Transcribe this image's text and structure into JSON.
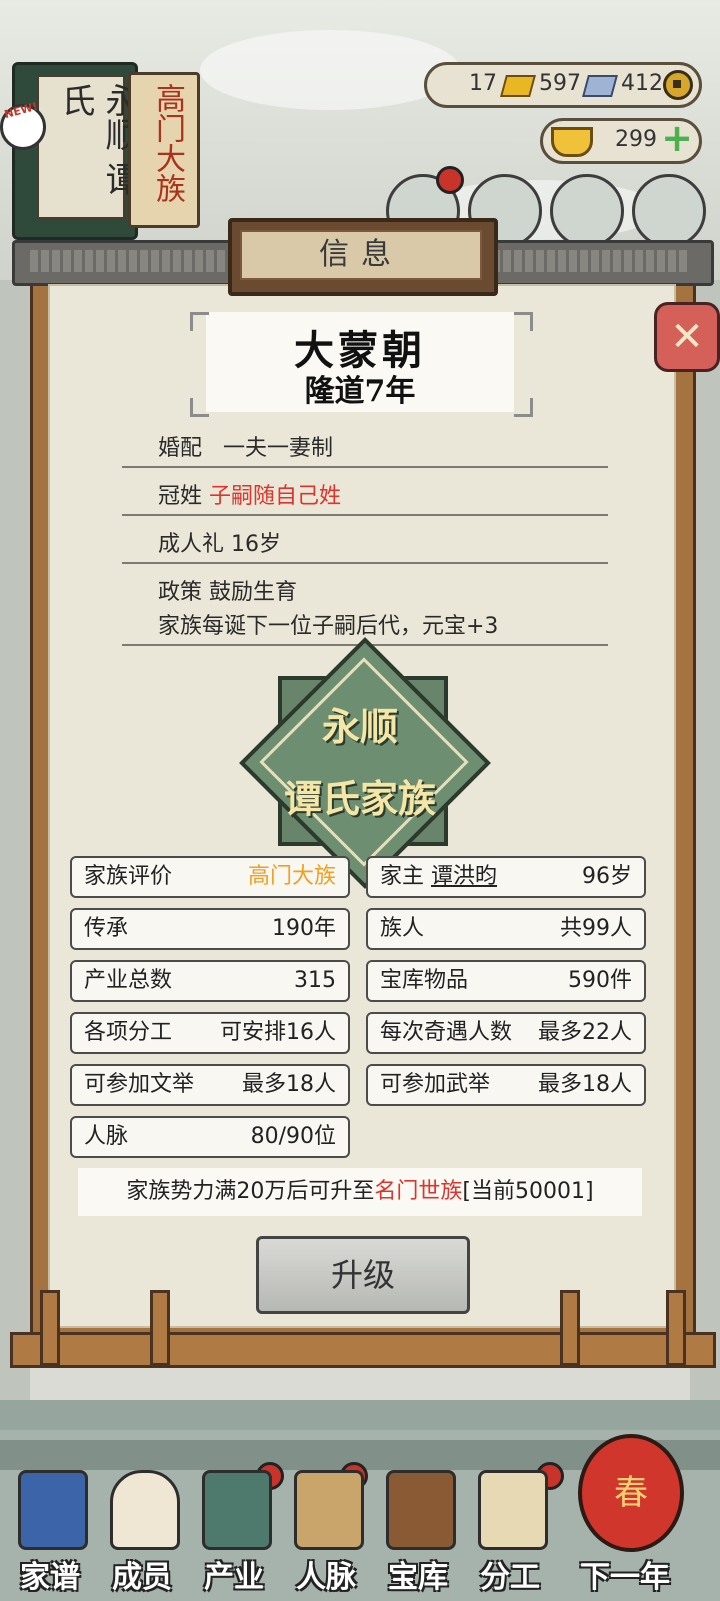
{
  "top_left": {
    "book_title": "永顺 谭氏",
    "book_subtitle": "高门大族",
    "new_badge": "NEW!"
  },
  "resources": {
    "gold_bars": "17",
    "silver_bars": "597",
    "coins": "412",
    "yuanbao": "299"
  },
  "dialog": {
    "title": "信息",
    "close_icon": "close-icon",
    "dynasty": "大蒙朝",
    "year": "隆道7年",
    "rules": [
      {
        "label": "婚配",
        "value": "一夫一妻制"
      },
      {
        "label": "冠姓",
        "value": "子嗣随自己姓"
      },
      {
        "label": "成人礼",
        "value": "16岁"
      },
      {
        "label": "政策",
        "value": "鼓励生育"
      }
    ],
    "policy_effect": "家族每诞下一位子嗣后代，元宝+3",
    "emblem": {
      "line1": "永顺",
      "line2": "谭氏家族"
    },
    "stats_left": [
      {
        "label": "家族评价",
        "value": "高门大族"
      },
      {
        "label": "传承",
        "value": "190年"
      },
      {
        "label": "产业总数",
        "value": "315"
      },
      {
        "label": "各项分工",
        "value": "可安排16人"
      },
      {
        "label": "可参加文举",
        "value": "最多18人"
      },
      {
        "label": "人脉",
        "value": "80/90位"
      }
    ],
    "stats_right": [
      {
        "label": "家主",
        "name": "谭洪昀",
        "value": "96岁"
      },
      {
        "label": "族人",
        "value": "共99人"
      },
      {
        "label": "宝库物品",
        "value": "590件"
      },
      {
        "label": "每次奇遇人数",
        "value": "最多22人"
      },
      {
        "label": "可参加武举",
        "value": "最多18人"
      }
    ],
    "notice": {
      "prefix": "家族势力满20万后可升至",
      "target": "名门世族",
      "suffix": "[当前50001]"
    },
    "upgrade_label": "升级"
  },
  "bottom_nav": [
    {
      "label": "家谱",
      "icon": "book-icon"
    },
    {
      "label": "成员",
      "icon": "person-icon"
    },
    {
      "label": "产业",
      "icon": "building-icon"
    },
    {
      "label": "人脉",
      "icon": "network-icon"
    },
    {
      "label": "宝库",
      "icon": "chest-icon"
    },
    {
      "label": "分工",
      "icon": "scroll-icon"
    },
    {
      "label": "下一年",
      "icon": "lantern-icon"
    }
  ],
  "lantern_char": "春",
  "colors": {
    "accent_red": "#e0332b",
    "accent_orange": "#f0a020",
    "panel": "#ebe7d8",
    "frame": "#a5733f"
  }
}
